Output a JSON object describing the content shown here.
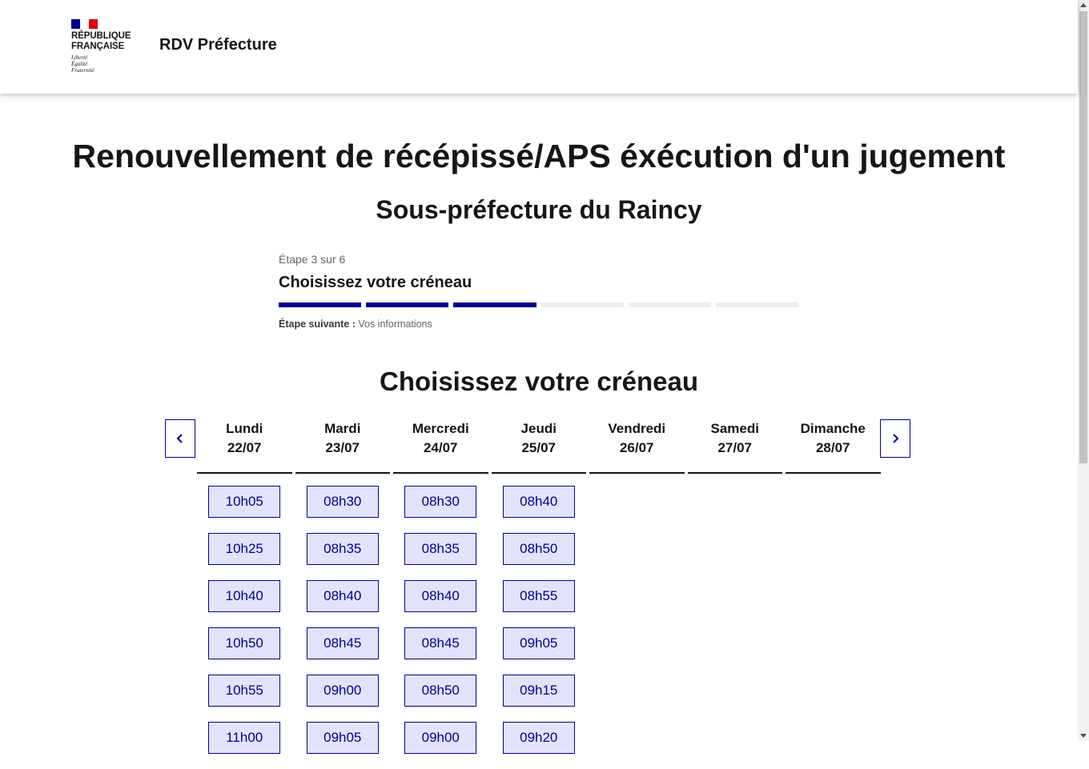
{
  "header": {
    "logo_line1": "RÉPUBLIQUE",
    "logo_line2": "FRANÇAISE",
    "motto1": "Liberté",
    "motto2": "Égalité",
    "motto3": "Fraternité",
    "site_title": "RDV Préfecture",
    "flag_colors": [
      "#000091",
      "#ffffff",
      "#e1000f"
    ]
  },
  "page": {
    "title": "Renouvellement de récépissé/APS éxécution d'un jugement",
    "subtitle": "Sous-préfecture du Raincy"
  },
  "stepper": {
    "state": "Étape 3 sur 6",
    "title": "Choisissez votre créneau",
    "current_step": 3,
    "total_steps": 6,
    "next_label": "Étape suivante :",
    "next_value": " Vos informations"
  },
  "slots_section": {
    "title": "Choisissez votre créneau",
    "prev_icon": "chevron-left-icon",
    "next_icon": "chevron-right-icon",
    "days": [
      {
        "name": "Lundi",
        "date": "22/07",
        "slots": [
          "10h05",
          "10h25",
          "10h40",
          "10h50",
          "10h55",
          "11h00"
        ]
      },
      {
        "name": "Mardi",
        "date": "23/07",
        "slots": [
          "08h30",
          "08h35",
          "08h40",
          "08h45",
          "09h00",
          "09h05"
        ]
      },
      {
        "name": "Mercredi",
        "date": "24/07",
        "slots": [
          "08h30",
          "08h35",
          "08h40",
          "08h45",
          "08h50",
          "09h00"
        ]
      },
      {
        "name": "Jeudi",
        "date": "25/07",
        "slots": [
          "08h40",
          "08h50",
          "08h55",
          "09h05",
          "09h15",
          "09h20"
        ]
      },
      {
        "name": "Vendredi",
        "date": "26/07",
        "slots": []
      },
      {
        "name": "Samedi",
        "date": "27/07",
        "slots": []
      },
      {
        "name": "Dimanche",
        "date": "28/07",
        "slots": []
      }
    ]
  },
  "colors": {
    "primary": "#000091",
    "slot_bg": "#e3e3fd",
    "step_inactive": "#eeeeee"
  }
}
